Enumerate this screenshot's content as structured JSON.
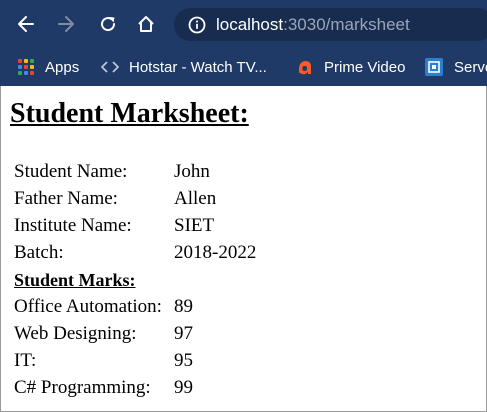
{
  "browser": {
    "url_host": "localhost",
    "url_rest": ":3030/marksheet",
    "bookmarks": [
      {
        "label": "Apps",
        "icon": "apps-grid-icon"
      },
      {
        "label": "Hotstar - Watch TV...",
        "icon": "code-brackets-icon"
      },
      {
        "label": "Prime Video",
        "icon": "prime-video-icon"
      },
      {
        "label": "Serve",
        "icon": "server-icon"
      }
    ],
    "colors": {
      "toolbar": "#1f3a66",
      "omnibox": "#172c4f"
    }
  },
  "page": {
    "title": "Student Marksheet:",
    "details": [
      {
        "label": "Student Name:",
        "value": "John"
      },
      {
        "label": "Father Name:",
        "value": "Allen"
      },
      {
        "label": "Institute Name:",
        "value": "SIET"
      },
      {
        "label": "Batch:",
        "value": "2018-2022"
      }
    ],
    "marks_heading": "Student Marks:",
    "marks": [
      {
        "subject": "Office Automation:",
        "score": "89"
      },
      {
        "subject": "Web Designing:",
        "score": "97"
      },
      {
        "subject": "IT:",
        "score": "95"
      },
      {
        "subject": "C# Programming:",
        "score": "99"
      }
    ]
  }
}
